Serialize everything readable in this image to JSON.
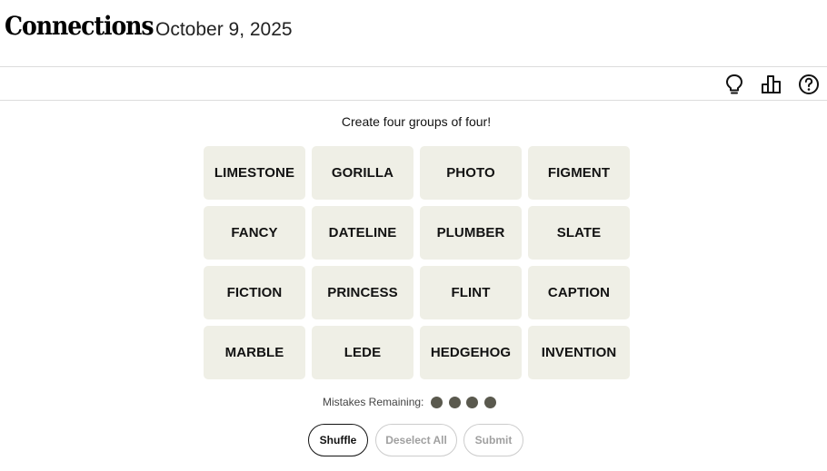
{
  "header": {
    "title": "Connections",
    "date": "October 9, 2025"
  },
  "toolbar": {
    "icons": [
      "lightbulb-icon",
      "leaderboard-icon",
      "help-icon"
    ]
  },
  "game": {
    "instructions": "Create four groups of four!",
    "tiles": [
      "LIMESTONE",
      "GORILLA",
      "PHOTO",
      "FIGMENT",
      "FANCY",
      "DATELINE",
      "PLUMBER",
      "SLATE",
      "FICTION",
      "PRINCESS",
      "FLINT",
      "CAPTION",
      "MARBLE",
      "LEDE",
      "HEDGEHOG",
      "INVENTION"
    ],
    "mistakes_label": "Mistakes Remaining:",
    "mistakes_remaining": 4
  },
  "buttons": {
    "shuffle": "Shuffle",
    "deselect_all": "Deselect All",
    "submit": "Submit"
  },
  "colors": {
    "tile_bg": "#efefe6",
    "dot": "#5a594e"
  }
}
